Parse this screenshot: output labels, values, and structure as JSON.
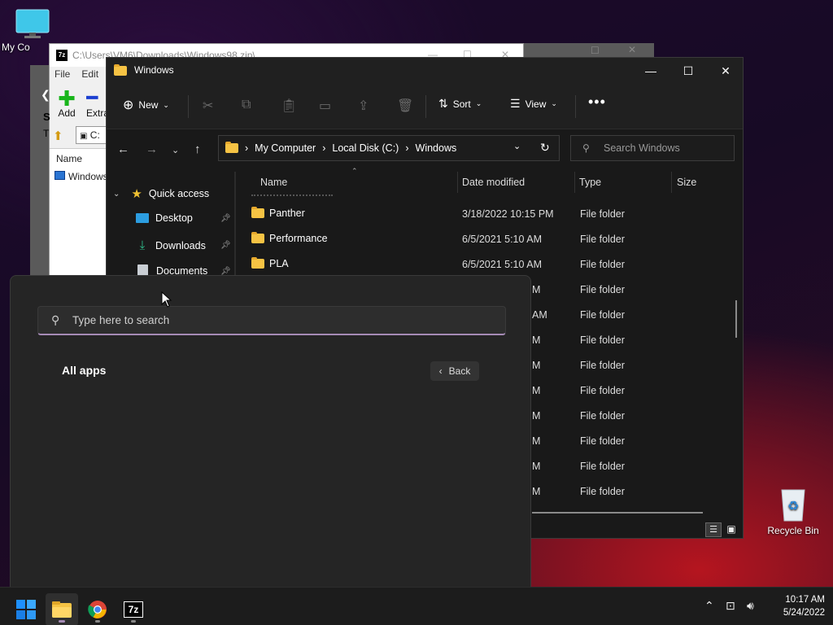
{
  "desktop": {
    "my_computer_label": "My Co",
    "recycle_bin_label": "Recycle Bin"
  },
  "zip_window": {
    "title": "C:\\Users\\VM6\\Downloads\\Windows98.zip\\",
    "menu": [
      "File",
      "Edit"
    ],
    "add_label": "Add",
    "extract_label": "Extra",
    "path_fragment": "C:",
    "col_name": "Name",
    "item_fragment": "Windows",
    "side_letters": [
      "S",
      "T"
    ]
  },
  "explorer": {
    "title": "Windows",
    "toolbar": {
      "new_label": "New",
      "sort_label": "Sort",
      "view_label": "View"
    },
    "address": {
      "crumbs": [
        "My Computer",
        "Local Disk (C:)",
        "Windows"
      ]
    },
    "search_placeholder": "Search Windows",
    "nav": {
      "quick_access": "Quick access",
      "items": [
        "Desktop",
        "Downloads",
        "Documents"
      ]
    },
    "columns": {
      "name": "Name",
      "date": "Date modified",
      "type": "Type",
      "size": "Size"
    },
    "rows": [
      {
        "name": "Panther",
        "date": "3/18/2022 10:15 PM",
        "type": "File folder"
      },
      {
        "name": "Performance",
        "date": "6/5/2021 5:10 AM",
        "type": "File folder"
      },
      {
        "name": "PLA",
        "date": "6/5/2021 5:10 AM",
        "type": "File folder"
      }
    ],
    "partial_rows": [
      {
        "date_tail": "M",
        "type": "File folder"
      },
      {
        "date_tail": "AM",
        "type": "File folder"
      },
      {
        "date_tail": "M",
        "type": "File folder"
      },
      {
        "date_tail": "M",
        "type": "File folder"
      },
      {
        "date_tail": "M",
        "type": "File folder"
      },
      {
        "date_tail": "M",
        "type": "File folder"
      },
      {
        "date_tail": "M",
        "type": "File folder"
      },
      {
        "date_tail": "M",
        "type": "File folder"
      },
      {
        "date_tail": "M",
        "type": "File folder"
      }
    ]
  },
  "start_menu": {
    "search_placeholder": "Type here to search",
    "all_apps": "All apps",
    "back_label": "Back"
  },
  "taskbar": {
    "time": "10:17 AM",
    "date": "5/24/2022",
    "apps": [
      "start-icon",
      "file-explorer-icon",
      "chrome-icon",
      "7zip-icon"
    ]
  },
  "colors": {
    "accent_underline": "#a68bb6",
    "folder": "#f6c344",
    "taskbar": "#1c1c1c"
  }
}
